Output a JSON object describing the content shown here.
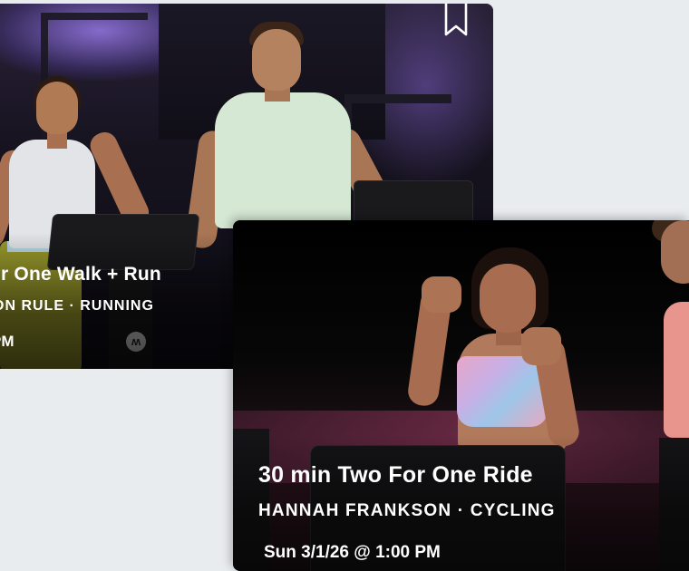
{
  "cards": [
    {
      "title": "or One Walk + Run",
      "subtitle": "ON RULE · RUNNING",
      "time": "PM",
      "bookmark_icon": "bookmark-icon",
      "logo_icon": "lululemon-logo-icon"
    },
    {
      "title": "30 min Two For One Ride",
      "subtitle": "HANNAH FRANKSON · CYCLING",
      "time": "Sun 3/1/26 @ 1:00 PM"
    }
  ],
  "colors": {
    "background": "#e9ecef",
    "text": "#ffffff",
    "card_accent_purple": "#9b7fe0",
    "card_accent_pink": "#be4678"
  }
}
